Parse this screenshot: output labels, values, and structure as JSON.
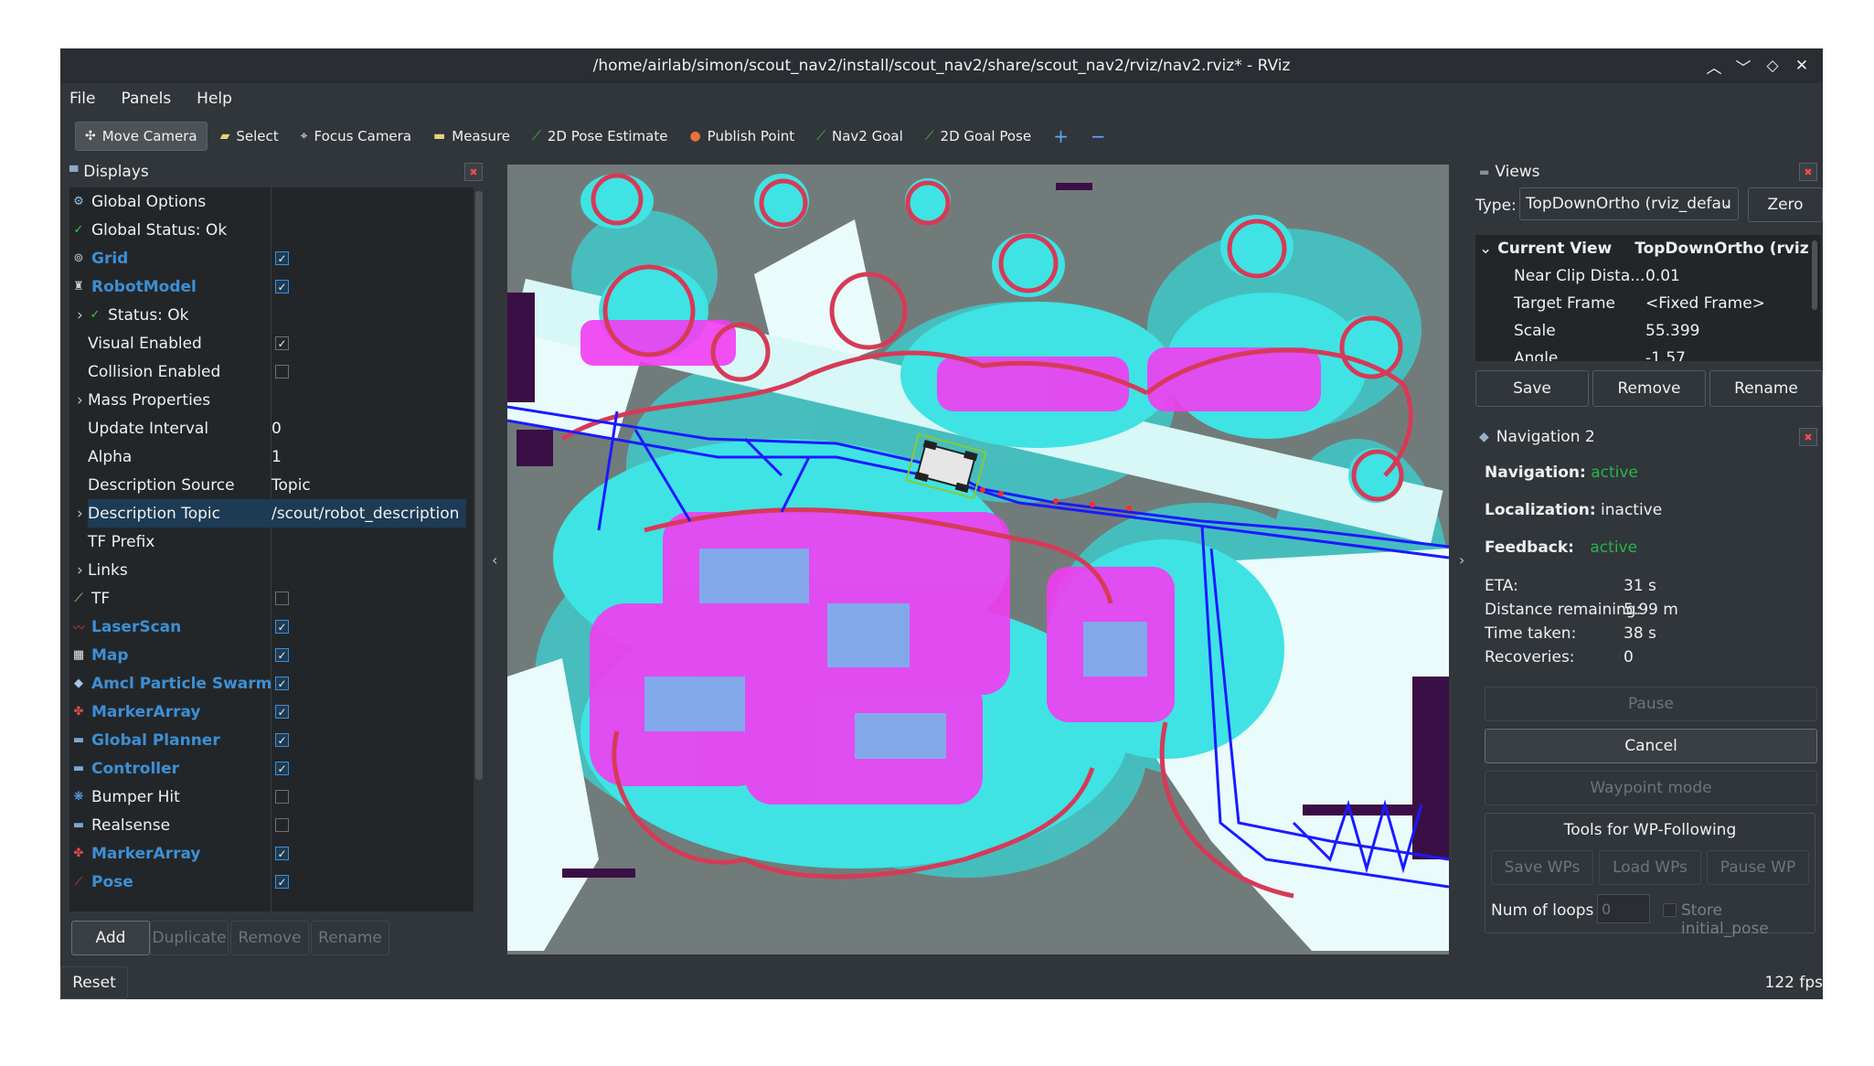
{
  "window": {
    "title": "/home/airlab/simon/scout_nav2/install/scout_nav2/share/scout_nav2/rviz/nav2.rviz* - RViz",
    "controls": [
      "︿",
      "﹀",
      "◇",
      "✕"
    ]
  },
  "menu": [
    "File",
    "Panels",
    "Help"
  ],
  "toolbar": {
    "tools": [
      {
        "label": "Move Camera",
        "icon": "move-icon",
        "glyph": "✣",
        "active": true
      },
      {
        "label": "Select",
        "icon": "select-icon",
        "glyph": "▰"
      },
      {
        "label": "Focus Camera",
        "icon": "focus-icon",
        "glyph": "⌖"
      },
      {
        "label": "Measure",
        "icon": "ruler-icon",
        "glyph": "▬"
      },
      {
        "label": "2D Pose Estimate",
        "icon": "arrow-green-icon",
        "glyph": "⟋"
      },
      {
        "label": "Publish Point",
        "icon": "pin-icon",
        "glyph": "●"
      },
      {
        "label": "Nav2 Goal",
        "icon": "arrow-green-icon",
        "glyph": "⟋"
      },
      {
        "label": "2D Goal Pose",
        "icon": "arrow-green-icon",
        "glyph": "⟋"
      }
    ],
    "add_glyph": "+",
    "remove_glyph": "−"
  },
  "displays": {
    "title": "Displays",
    "rows": [
      {
        "name": "Global Options",
        "indent": 0,
        "icon": "gear-icon",
        "glyph": "⚙"
      },
      {
        "name": "Global Status: Ok",
        "indent": 0,
        "icon": "check-icon",
        "glyph": "✓"
      },
      {
        "name": "Grid",
        "indent": 0,
        "icon": "grid-icon",
        "glyph": "⊚",
        "blue": true,
        "check": true
      },
      {
        "name": "RobotModel",
        "indent": 0,
        "icon": "robot-icon",
        "glyph": "♜",
        "blue": true,
        "check": true
      },
      {
        "name": "Status: Ok",
        "indent": 1,
        "icon": "check-icon",
        "glyph": "✓",
        "expander": true
      },
      {
        "name": "Visual Enabled",
        "indent": 1,
        "check": true
      },
      {
        "name": "Collision Enabled",
        "indent": 1,
        "check": false
      },
      {
        "name": "Mass Properties",
        "indent": 1,
        "expander": true
      },
      {
        "name": "Update Interval",
        "indent": 1,
        "value": "0"
      },
      {
        "name": "Alpha",
        "indent": 1,
        "value": "1"
      },
      {
        "name": "Description Source",
        "indent": 1,
        "value": "Topic"
      },
      {
        "name": "Description Topic",
        "indent": 1,
        "value": "/scout/robot_description",
        "selected": true,
        "expander": true
      },
      {
        "name": "TF Prefix",
        "indent": 1
      },
      {
        "name": "Links",
        "indent": 1,
        "expander": true
      },
      {
        "name": "TF",
        "indent": 0,
        "icon": "tf-icon",
        "glyph": "⟋",
        "check": false
      },
      {
        "name": "LaserScan",
        "indent": 0,
        "icon": "laser-icon",
        "glyph": "〰",
        "blue": true,
        "check": true
      },
      {
        "name": "Map",
        "indent": 0,
        "icon": "map-icon",
        "glyph": "▦",
        "blue": true,
        "check": true
      },
      {
        "name": "Amcl Particle Swarm",
        "indent": 0,
        "icon": "diamond-icon",
        "glyph": "◆",
        "blue": true,
        "check": true
      },
      {
        "name": "MarkerArray",
        "indent": 0,
        "icon": "marker-icon",
        "glyph": "✤",
        "blue": true,
        "check": true
      },
      {
        "name": "Global Planner",
        "indent": 0,
        "icon": "folder-icon",
        "glyph": "▬",
        "blue": true,
        "check": true
      },
      {
        "name": "Controller",
        "indent": 0,
        "icon": "folder-icon",
        "glyph": "▬",
        "blue": true,
        "check": true
      },
      {
        "name": "Bumper Hit",
        "indent": 0,
        "icon": "dots-icon",
        "glyph": "❋",
        "check": false
      },
      {
        "name": "Realsense",
        "indent": 0,
        "icon": "folder-icon",
        "glyph": "▬",
        "check": false
      },
      {
        "name": "MarkerArray",
        "indent": 0,
        "icon": "marker-icon",
        "glyph": "✤",
        "blue": true,
        "check": true
      },
      {
        "name": "Pose",
        "indent": 0,
        "icon": "pose-icon",
        "glyph": "⟋",
        "blue": true,
        "check": true
      }
    ],
    "buttons": [
      "Add",
      "Duplicate",
      "Remove",
      "Rename"
    ]
  },
  "views": {
    "title": "Views",
    "type_label": "Type:",
    "type_value": "TopDownOrtho (rviz_defau",
    "zero_label": "Zero",
    "current_view": "Current View",
    "current_view_value": "TopDownOrtho (rviz",
    "props": [
      {
        "k": "Near Clip Dista...",
        "v": "0.01"
      },
      {
        "k": "Target Frame",
        "v": "<Fixed Frame>"
      },
      {
        "k": "Scale",
        "v": "55.399"
      },
      {
        "k": "Angle",
        "v": "-1.57"
      }
    ],
    "buttons": [
      "Save",
      "Remove",
      "Rename"
    ]
  },
  "nav": {
    "title": "Navigation 2",
    "navigation_label": "Navigation:",
    "navigation_value": "active",
    "localization_label": "Localization:",
    "localization_value": "inactive",
    "feedback_label": "Feedback:",
    "feedback_value": "active",
    "stats": [
      {
        "k": "ETA:",
        "v": "31 s"
      },
      {
        "k": "Distance remaining:",
        "v": "5.99 m"
      },
      {
        "k": "Time taken:",
        "v": "38 s"
      },
      {
        "k": "Recoveries:",
        "v": "0"
      }
    ],
    "pause": "Pause",
    "cancel": "Cancel",
    "waypoint": "Waypoint mode",
    "wp_group": "Tools for WP-Following",
    "wp_buttons": [
      "Save WPs",
      "Load WPs",
      "Pause WP"
    ],
    "loops_label": "Num of loops",
    "loops_value": "0",
    "store_label": "Store initial_pose"
  },
  "status": {
    "reset": "Reset",
    "fps": "122 fps"
  },
  "colors": {
    "accent": "#3d8fd4",
    "active": "#27b54a",
    "map_bg": "#717c7a",
    "inflation": "#3fe3e3",
    "lethal": "#ff33ff",
    "path": "#1a1aff"
  }
}
